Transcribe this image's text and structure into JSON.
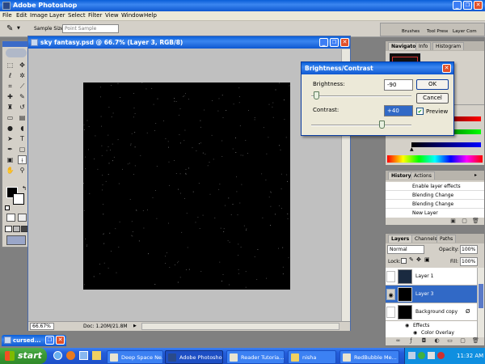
{
  "app": {
    "title": "Adobe Photoshop",
    "menu": [
      "File",
      "Edit",
      "Image",
      "Layer",
      "Select",
      "Filter",
      "View",
      "Window",
      "Help"
    ],
    "min_label": "_",
    "restore_label": "❐",
    "close_label": "✕"
  },
  "options_bar": {
    "sample_size_label": "Sample Size:",
    "sample_size_value": "Point Sample",
    "well_tabs": [
      "Brushes",
      "Tool Presets",
      "Layer Comps"
    ]
  },
  "document": {
    "title": "sky fantasy.psd @ 66.7% (Layer 3, RGB/8)",
    "zoom": "66.67%",
    "doc_info": "Doc: 1.20M/21.8M"
  },
  "dialog": {
    "title": "Brightness/Contrast",
    "brightness_label": "Brightness:",
    "brightness_value": "-90",
    "brightness_fraction": 0.05,
    "contrast_label": "Contrast:",
    "contrast_value": "+40",
    "contrast_fraction": 0.7,
    "ok_label": "OK",
    "cancel_label": "Cancel",
    "preview_label": "Preview",
    "preview_checked": true
  },
  "navigator_panel": {
    "tabs": [
      "Navigator",
      "Info",
      "Histogram"
    ]
  },
  "history_panel": {
    "tabs": [
      "History",
      "Actions"
    ],
    "items": [
      "Enable layer effects",
      "Blending Change",
      "Blending Change",
      "New Layer"
    ]
  },
  "layers_panel": {
    "tabs": [
      "Layers",
      "Channels",
      "Paths"
    ],
    "blend_mode": "Normal",
    "opacity_label": "Opacity:",
    "opacity_value": "100%",
    "lock_label": "Lock:",
    "fill_label": "Fill:",
    "fill_value": "100%",
    "layers": [
      {
        "name": "Layer 1",
        "selected": false,
        "visible": false
      },
      {
        "name": "Layer 3",
        "selected": true,
        "visible": true
      },
      {
        "name": "Background copy",
        "selected": false,
        "visible": false
      }
    ],
    "effects_label": "Effects",
    "color_overlay_label": "Color Overlay"
  },
  "minimized_window": {
    "title": "cursed..."
  },
  "taskbar": {
    "start_label": "start",
    "tasks": [
      "Deep Space Ne...",
      "Adobe Photoshop",
      "Reader Tutoria...",
      "nisha",
      "RedBubble Me..."
    ],
    "clock": "11:32 AM"
  },
  "colors": {
    "xp_blue": "#245edb",
    "photoshop_gray": "#808080",
    "panel_gray": "#d4d0c8",
    "selected_layer": "#3169c6",
    "start_green": "#3c9a36"
  }
}
